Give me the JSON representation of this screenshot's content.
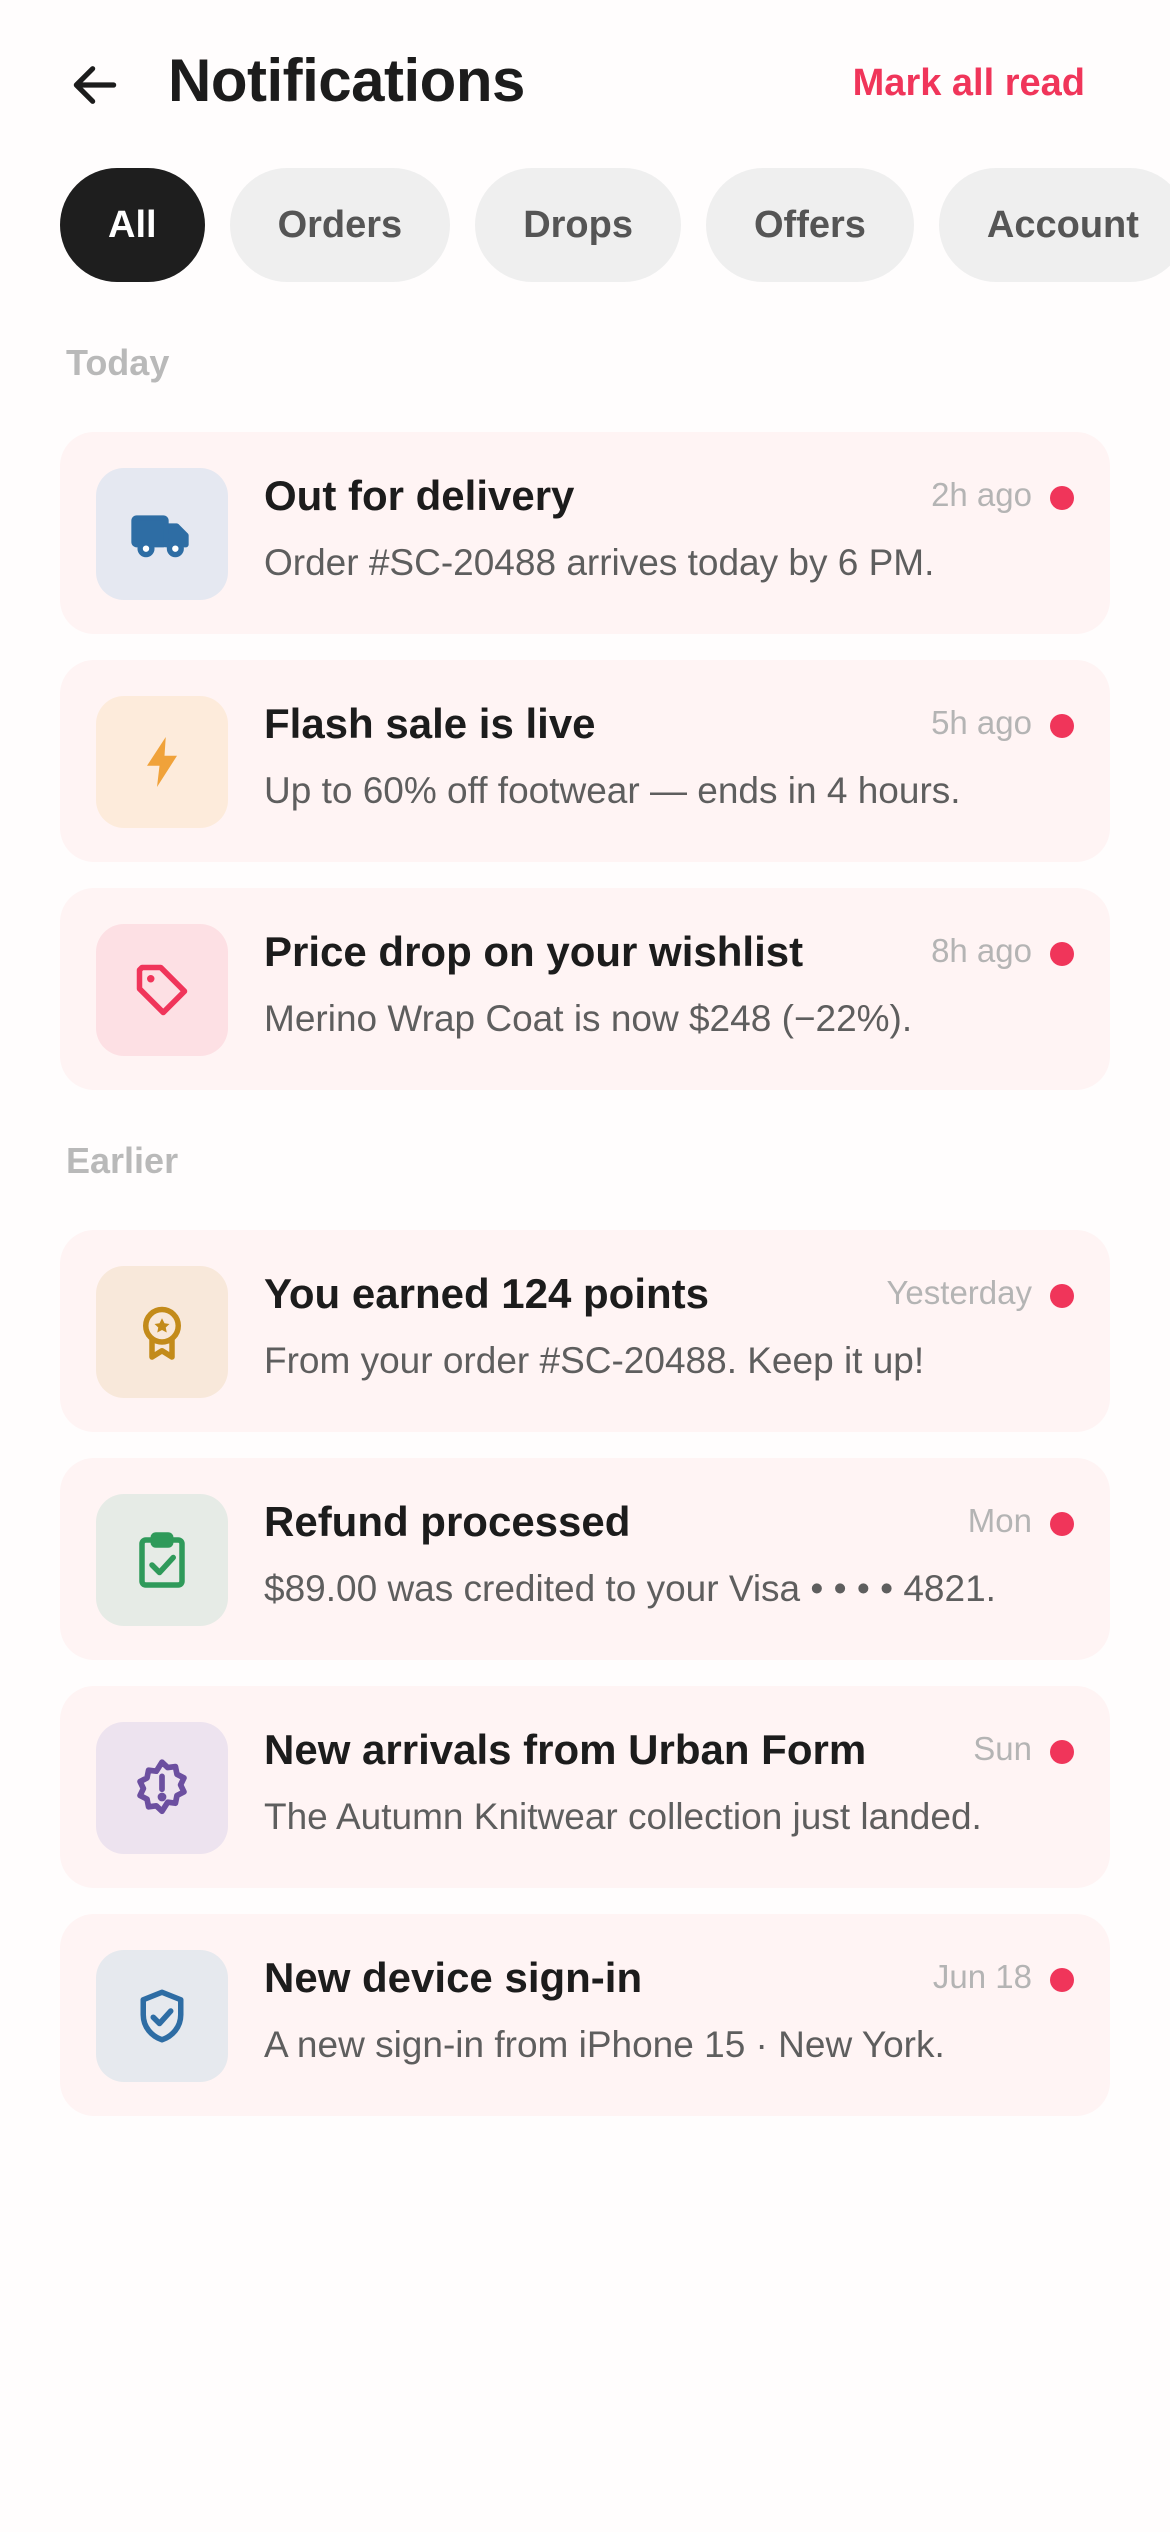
{
  "header": {
    "title": "Notifications",
    "mark_all_label": "Mark all read"
  },
  "filters": [
    "All",
    "Orders",
    "Drops",
    "Offers",
    "Account"
  ],
  "sections": {
    "today": "Today",
    "earlier": "Earlier"
  },
  "notifications": [
    {
      "icon": "truck-icon",
      "title": "Out for delivery",
      "body": "Order #SC-20488 arrives today by 6 PM.",
      "time": "2h ago",
      "unread": true,
      "icon_color": "#2e6da4",
      "bg": "#e5e8f1"
    },
    {
      "icon": "lightning-icon",
      "title": "Flash sale is live",
      "body": "Up to 60% off footwear — ends in 4 hours.",
      "time": "5h ago",
      "unread": true,
      "icon_color": "#f0a23a",
      "bg": "#fdebdb"
    },
    {
      "icon": "tag-icon",
      "title": "Price drop on your wishlist",
      "body": "Merino Wrap Coat is now $248 (−22%).",
      "time": "8h ago",
      "unread": true,
      "icon_color": "#f0355a",
      "bg": "#fde0e4"
    },
    {
      "icon": "badge-icon",
      "title": "You earned 124 points",
      "body": "From your order #SC-20488. Keep it up!",
      "time": "Yesterday",
      "unread": true,
      "icon_color": "#c38b1a",
      "bg": "#f8e8da"
    },
    {
      "icon": "clipboard-check-icon",
      "title": "Refund processed",
      "body": "$89.00 was credited to your Visa • • • • 4821.",
      "time": "Mon",
      "unread": true,
      "icon_color": "#2f9a5a",
      "bg": "#e6ebe6"
    },
    {
      "icon": "alert-badge-icon",
      "title": "New arrivals from Urban Form",
      "body": "The Autumn Knitwear collection just landed.",
      "time": "Sun",
      "unread": true,
      "icon_color": "#6c4fa0",
      "bg": "#ede3ef"
    },
    {
      "icon": "shield-check-icon",
      "title": "New device sign-in",
      "body": "A new sign-in from iPhone 15 · New York.",
      "time": "Jun 18",
      "unread": true,
      "icon_color": "#2e6da4",
      "bg": "#e6e9ee"
    }
  ]
}
